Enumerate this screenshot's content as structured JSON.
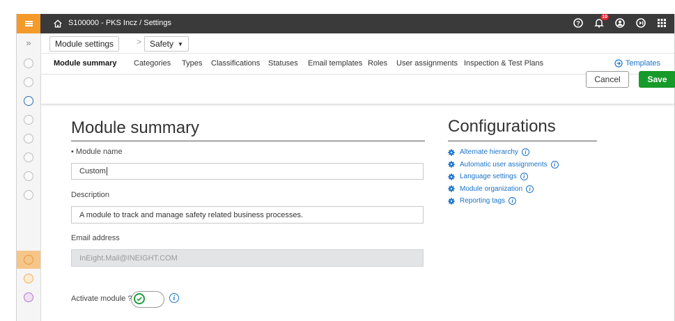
{
  "app": {
    "breadcrumb": "S100000 - PKS Incz  /  Settings",
    "notification_count": "10",
    "accent": "#f39a2b"
  },
  "subnav": {
    "module_settings": "Module settings",
    "module_dropdown": "Safety"
  },
  "tabs": [
    {
      "label": "Module summary",
      "active": true
    },
    {
      "label": "Categories"
    },
    {
      "label": "Types"
    },
    {
      "label": "Classifications"
    },
    {
      "label": "Statuses"
    },
    {
      "label": "Email templates"
    },
    {
      "label": "Roles"
    },
    {
      "label": "User assignments"
    },
    {
      "label": "Inspection & Test Plans"
    }
  ],
  "templates_link": "Templates",
  "actions": {
    "cancel": "Cancel",
    "save": "Save",
    "save_color": "#169a29"
  },
  "summary": {
    "title": "Module summary",
    "module_name_label": "• Module name",
    "module_name_value": "Custom",
    "description_label": "Description",
    "description_value": "A module to track and manage safety related business processes.",
    "email_label": "Email address",
    "email_placeholder": "InEight.Mail@INEIGHT.COM",
    "activate_label": "Activate module ?",
    "activate_on": true
  },
  "configurations": {
    "title": "Configurations",
    "items": [
      "Alternate hierarchy",
      "Automatic user assignments",
      "Language settings",
      "Module organization",
      "Reporting tags"
    ]
  },
  "icons": [
    "hamburger-icon",
    "home-icon",
    "help-icon",
    "bell-icon",
    "user-icon",
    "logout-icon",
    "apps-grid-icon",
    "chevron-right-icon",
    "caret-down-icon",
    "arrow-circle-icon",
    "gear-icon",
    "info-icon",
    "check-icon"
  ]
}
